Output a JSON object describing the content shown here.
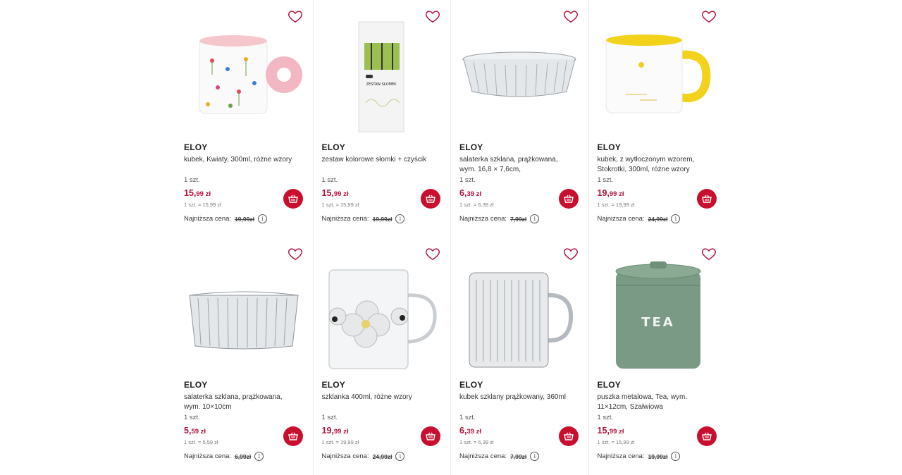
{
  "products": [
    {
      "brand": "ELOY",
      "name": "kubek, Kwiaty, 300ml, różne wzory",
      "qty": "1 szt.",
      "price_int": "15,",
      "price_dec": "99",
      "price_cur": " zł",
      "unit": "1 szt. = 15,99 zł",
      "lowest_label": "Najniższa cena:",
      "lowest_price": "19,99zł",
      "icon": "flower-mug-image"
    },
    {
      "brand": "ELOY",
      "name": "zestaw kolorowe słomki + czyścik",
      "qty": "1 szt.",
      "price_int": "15,",
      "price_dec": "99",
      "price_cur": " zł",
      "unit": "1 szt. = 15,99 zł",
      "lowest_label": "Najniższa cena:",
      "lowest_price": "19,99zł",
      "icon": "straws-package-image",
      "package_text": "ZESTAW SŁOMEK"
    },
    {
      "brand": "ELOY",
      "name": "salaterka szklana, prążkowana, wym. 16,8 × 7,6cm,",
      "qty": "1 szt.",
      "price_int": "6,",
      "price_dec": "39",
      "price_cur": " zł",
      "unit": "1 szt. = 6,39 zł",
      "lowest_label": "Najniższa cena:",
      "lowest_price": "7,99zł",
      "icon": "glass-oval-bowl-image"
    },
    {
      "brand": "ELOY",
      "name": "kubek, z wytłoczonym wzorem, Stokrotki, 300ml, różne wzory",
      "qty": "1 szt.",
      "price_int": "19,",
      "price_dec": "99",
      "price_cur": " zł",
      "unit": "1 szt. = 19,99 zł",
      "lowest_label": "Najniższa cena:",
      "lowest_price": "24,99zł",
      "icon": "yellow-mug-image"
    },
    {
      "brand": "ELOY",
      "name": "salaterka szklana, prążkowana, wym. 10×10cm",
      "qty": "1 szt.",
      "price_int": "5,",
      "price_dec": "59",
      "price_cur": " zł",
      "unit": "1 szt. = 5,59 zł",
      "lowest_label": "Najniższa cena:",
      "lowest_price": "6,99zł",
      "icon": "glass-square-bowl-image"
    },
    {
      "brand": "ELOY",
      "name": "szklanka 400ml, różne wzory",
      "qty": "1 szt.",
      "price_int": "19,",
      "price_dec": "99",
      "price_cur": " zł",
      "unit": "1 szt. = 19,99 zł",
      "lowest_label": "Najniższa cena:",
      "lowest_price": "24,99zł",
      "icon": "daisy-glass-mug-image"
    },
    {
      "brand": "ELOY",
      "name": "kubek szklany prążkowany, 360ml",
      "qty": "1 szt.",
      "price_int": "6,",
      "price_dec": "39",
      "price_cur": " zł",
      "unit": "1 szt. = 6,39 zł",
      "lowest_label": "Najniższa cena:",
      "lowest_price": "7,99zł",
      "icon": "ribbed-glass-mug-image"
    },
    {
      "brand": "ELOY",
      "name": "puszka metalowa, Tea, wym. 11×12cm, Szałwiowa",
      "qty": "1 szt.",
      "price_int": "15,",
      "price_dec": "99",
      "price_cur": " zł",
      "unit": "1 szt. = 15,99 zł",
      "lowest_label": "Najniższa cena:",
      "lowest_price": "19,99zł",
      "icon": "tea-tin-image",
      "tin_text": "TEA"
    }
  ],
  "colors": {
    "accent": "#c8102e",
    "price": "#b3123c",
    "tin": "#7a9a85"
  }
}
